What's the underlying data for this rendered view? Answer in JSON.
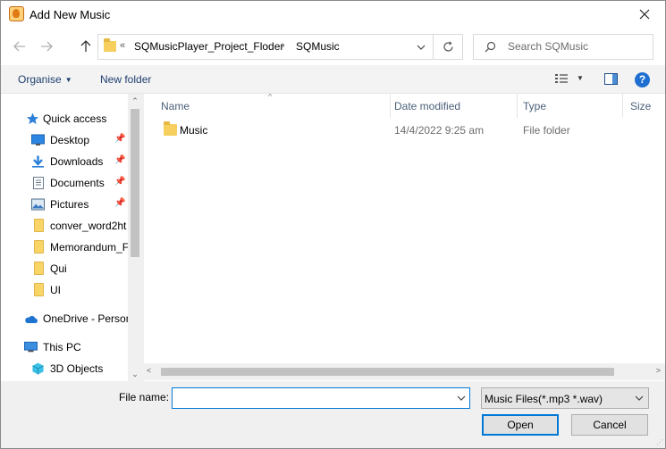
{
  "window": {
    "title": "Add New Music",
    "icon": "app-music-icon",
    "close_icon": "close-icon"
  },
  "nav": {
    "back_icon": "back-arrow-icon",
    "forward_icon": "forward-arrow-icon",
    "up_icon": "up-arrow-icon",
    "address": {
      "overflow_marker": "«",
      "crumbs": [
        "SQMusicPlayer_Project_Floder",
        "SQMusic"
      ],
      "separator": "›"
    },
    "refresh_icon": "refresh-icon",
    "search": {
      "placeholder": "Search SQMusic",
      "value": ""
    }
  },
  "toolbar": {
    "organise_label": "Organise",
    "new_folder_label": "New folder",
    "view_icon": "view-options-icon",
    "preview_pane_icon": "preview-pane-icon",
    "help_icon": "help-icon",
    "help_glyph": "?"
  },
  "sidebar": {
    "items": [
      {
        "label": "Quick access",
        "icon": "star-icon",
        "pinned": false
      },
      {
        "label": "Desktop",
        "icon": "desktop-icon",
        "pinned": true
      },
      {
        "label": "Downloads",
        "icon": "download-icon",
        "pinned": true
      },
      {
        "label": "Documents",
        "icon": "documents-icon",
        "pinned": true
      },
      {
        "label": "Pictures",
        "icon": "pictures-icon",
        "pinned": true
      },
      {
        "label": "conver_word2ht",
        "icon": "folder-icon",
        "pinned": false
      },
      {
        "label": "Memorandum_F",
        "icon": "folder-icon",
        "pinned": false
      },
      {
        "label": "Qui",
        "icon": "folder-icon",
        "pinned": false
      },
      {
        "label": "UI",
        "icon": "folder-icon",
        "pinned": false
      },
      {
        "label": "OneDrive - Person",
        "icon": "cloud-icon",
        "pinned": false
      },
      {
        "label": "This PC",
        "icon": "computer-icon",
        "pinned": false
      },
      {
        "label": "3D Objects",
        "icon": "3d-objects-icon",
        "pinned": false
      }
    ]
  },
  "content": {
    "columns": [
      "Name",
      "Date modified",
      "Type",
      "Size"
    ],
    "rows": [
      {
        "name": "Music",
        "date_modified": "14/4/2022 9:25 am",
        "type": "File folder",
        "size": ""
      }
    ]
  },
  "footer": {
    "file_name_label": "File name:",
    "file_name_value": "",
    "file_type_filter": "Music Files(*.mp3 *.wav)",
    "open_label": "Open",
    "cancel_label": "Cancel"
  },
  "colors": {
    "accent": "#0078d7",
    "folder": "#f7cf5f",
    "link_text": "#1e3f6e"
  }
}
